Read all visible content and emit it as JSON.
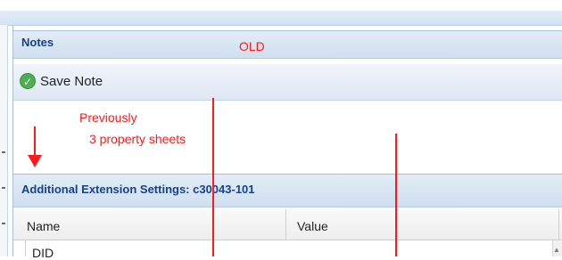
{
  "notes_panel": {
    "title": "Notes",
    "annotation": "OLD",
    "toolbar": {
      "save_label": "Save Note",
      "save_icon": "check-circle-icon"
    }
  },
  "annotation": {
    "line1": "Previously",
    "line2": "3 property sheets",
    "arrow": "down-arrow",
    "color": "#ff1a1a"
  },
  "extension_panel": {
    "title": "Additional Extension Settings: c30043-101",
    "columns": [
      "Name",
      "Value"
    ],
    "rows": [
      {
        "name": "DID",
        "value": ""
      }
    ]
  },
  "colors": {
    "header_text": "#15428b",
    "accent": "#ff1a1a",
    "panel_header": "#d8e4f3"
  }
}
